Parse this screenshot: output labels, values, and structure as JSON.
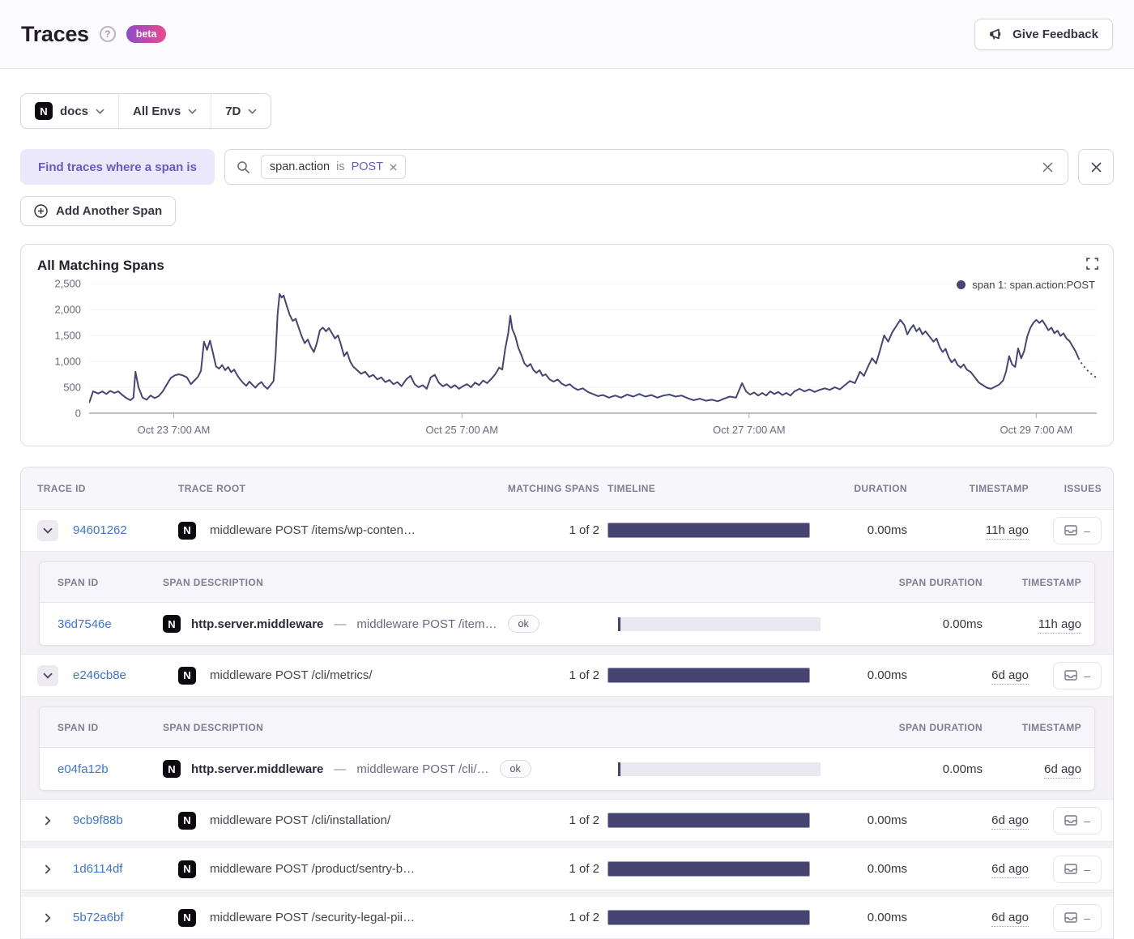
{
  "colors": {
    "accent_purple": "#675ac8",
    "link_blue": "#3d74db",
    "chart_line": "#444674",
    "beta_gradient_from": "#8d4bc9",
    "beta_gradient_to": "#ec4a8c"
  },
  "header": {
    "title": "Traces",
    "beta_label": "beta",
    "feedback_label": "Give Feedback",
    "help_glyph": "?"
  },
  "filters": {
    "project_initial": "N",
    "project": "docs",
    "environment": "All Envs",
    "period": "7D"
  },
  "search": {
    "find_label": "Find traces where a span is",
    "chip": {
      "key": "span.action",
      "op": "is",
      "value": "POST"
    },
    "add_span_label": "Add Another Span"
  },
  "chart_data": {
    "type": "line",
    "title": "All Matching Spans",
    "xlabel": "",
    "ylabel": "",
    "ylim": [
      0,
      2500
    ],
    "y_ticks": [
      0,
      500,
      1000,
      1500,
      2000,
      2500
    ],
    "grid": true,
    "legend_position": "top-right",
    "x_ticks": [
      {
        "label": "Oct 23 7:00 AM",
        "pos": 0.084
      },
      {
        "label": "Oct 25 7:00 AM",
        "pos": 0.37
      },
      {
        "label": "Oct 27 7:00 AM",
        "pos": 0.655
      },
      {
        "label": "Oct 29 7:00 AM",
        "pos": 0.94
      }
    ],
    "dashed_tail_points": 5,
    "series": [
      {
        "name": "span 1: span.action:POST",
        "color": "#444674",
        "points": [
          [
            0.0,
            200
          ],
          [
            0.004,
            420
          ],
          [
            0.009,
            380
          ],
          [
            0.013,
            420
          ],
          [
            0.017,
            370
          ],
          [
            0.021,
            430
          ],
          [
            0.025,
            390
          ],
          [
            0.029,
            420
          ],
          [
            0.033,
            350
          ],
          [
            0.037,
            290
          ],
          [
            0.041,
            250
          ],
          [
            0.044,
            300
          ],
          [
            0.046,
            800
          ],
          [
            0.049,
            500
          ],
          [
            0.053,
            300
          ],
          [
            0.057,
            260
          ],
          [
            0.061,
            340
          ],
          [
            0.065,
            290
          ],
          [
            0.069,
            330
          ],
          [
            0.073,
            420
          ],
          [
            0.077,
            550
          ],
          [
            0.081,
            680
          ],
          [
            0.085,
            730
          ],
          [
            0.089,
            750
          ],
          [
            0.093,
            730
          ],
          [
            0.097,
            690
          ],
          [
            0.101,
            560
          ],
          [
            0.105,
            640
          ],
          [
            0.108,
            700
          ],
          [
            0.111,
            820
          ],
          [
            0.114,
            1380
          ],
          [
            0.117,
            1220
          ],
          [
            0.12,
            1400
          ],
          [
            0.123,
            1150
          ],
          [
            0.126,
            900
          ],
          [
            0.129,
            860
          ],
          [
            0.132,
            930
          ],
          [
            0.135,
            830
          ],
          [
            0.138,
            890
          ],
          [
            0.141,
            790
          ],
          [
            0.144,
            840
          ],
          [
            0.147,
            730
          ],
          [
            0.15,
            650
          ],
          [
            0.153,
            580
          ],
          [
            0.156,
            530
          ],
          [
            0.159,
            610
          ],
          [
            0.162,
            550
          ],
          [
            0.165,
            490
          ],
          [
            0.168,
            560
          ],
          [
            0.171,
            600
          ],
          [
            0.174,
            520
          ],
          [
            0.177,
            470
          ],
          [
            0.18,
            540
          ],
          [
            0.183,
            620
          ],
          [
            0.185,
            1100
          ],
          [
            0.187,
            1900
          ],
          [
            0.189,
            2300
          ],
          [
            0.191,
            2230
          ],
          [
            0.193,
            2270
          ],
          [
            0.196,
            2080
          ],
          [
            0.199,
            1900
          ],
          [
            0.202,
            1780
          ],
          [
            0.205,
            1820
          ],
          [
            0.208,
            1650
          ],
          [
            0.211,
            1480
          ],
          [
            0.214,
            1350
          ],
          [
            0.217,
            1420
          ],
          [
            0.22,
            1280
          ],
          [
            0.223,
            1180
          ],
          [
            0.226,
            1350
          ],
          [
            0.229,
            1600
          ],
          [
            0.232,
            1650
          ],
          [
            0.235,
            1580
          ],
          [
            0.238,
            1640
          ],
          [
            0.241,
            1540
          ],
          [
            0.244,
            1440
          ],
          [
            0.247,
            1500
          ],
          [
            0.25,
            1320
          ],
          [
            0.253,
            1100
          ],
          [
            0.256,
            1180
          ],
          [
            0.259,
            1000
          ],
          [
            0.262,
            900
          ],
          [
            0.266,
            830
          ],
          [
            0.27,
            760
          ],
          [
            0.274,
            800
          ],
          [
            0.278,
            700
          ],
          [
            0.282,
            740
          ],
          [
            0.286,
            650
          ],
          [
            0.29,
            690
          ],
          [
            0.294,
            600
          ],
          [
            0.298,
            640
          ],
          [
            0.302,
            560
          ],
          [
            0.306,
            600
          ],
          [
            0.31,
            520
          ],
          [
            0.315,
            660
          ],
          [
            0.319,
            720
          ],
          [
            0.323,
            560
          ],
          [
            0.327,
            500
          ],
          [
            0.331,
            540
          ],
          [
            0.335,
            470
          ],
          [
            0.339,
            690
          ],
          [
            0.343,
            740
          ],
          [
            0.347,
            590
          ],
          [
            0.351,
            520
          ],
          [
            0.355,
            560
          ],
          [
            0.359,
            490
          ],
          [
            0.363,
            540
          ],
          [
            0.367,
            470
          ],
          [
            0.371,
            520
          ],
          [
            0.375,
            560
          ],
          [
            0.379,
            500
          ],
          [
            0.383,
            590
          ],
          [
            0.387,
            540
          ],
          [
            0.391,
            630
          ],
          [
            0.395,
            580
          ],
          [
            0.399,
            660
          ],
          [
            0.403,
            750
          ],
          [
            0.407,
            880
          ],
          [
            0.41,
            840
          ],
          [
            0.413,
            1250
          ],
          [
            0.416,
            1550
          ],
          [
            0.418,
            1880
          ],
          [
            0.42,
            1620
          ],
          [
            0.423,
            1480
          ],
          [
            0.426,
            1260
          ],
          [
            0.429,
            1120
          ],
          [
            0.432,
            960
          ],
          [
            0.435,
            900
          ],
          [
            0.438,
            950
          ],
          [
            0.441,
            830
          ],
          [
            0.444,
            780
          ],
          [
            0.447,
            830
          ],
          [
            0.45,
            720
          ],
          [
            0.453,
            750
          ],
          [
            0.457,
            650
          ],
          [
            0.461,
            610
          ],
          [
            0.465,
            650
          ],
          [
            0.469,
            570
          ],
          [
            0.473,
            530
          ],
          [
            0.477,
            560
          ],
          [
            0.481,
            490
          ],
          [
            0.485,
            450
          ],
          [
            0.49,
            480
          ],
          [
            0.495,
            410
          ],
          [
            0.5,
            370
          ],
          [
            0.505,
            330
          ],
          [
            0.51,
            350
          ],
          [
            0.516,
            300
          ],
          [
            0.522,
            340
          ],
          [
            0.528,
            300
          ],
          [
            0.534,
            360
          ],
          [
            0.54,
            320
          ],
          [
            0.546,
            370
          ],
          [
            0.552,
            320
          ],
          [
            0.558,
            350
          ],
          [
            0.564,
            300
          ],
          [
            0.57,
            340
          ],
          [
            0.576,
            360
          ],
          [
            0.582,
            320
          ],
          [
            0.588,
            340
          ],
          [
            0.594,
            290
          ],
          [
            0.6,
            250
          ],
          [
            0.606,
            280
          ],
          [
            0.612,
            240
          ],
          [
            0.618,
            260
          ],
          [
            0.624,
            230
          ],
          [
            0.63,
            280
          ],
          [
            0.636,
            320
          ],
          [
            0.642,
            300
          ],
          [
            0.648,
            580
          ],
          [
            0.652,
            420
          ],
          [
            0.656,
            360
          ],
          [
            0.66,
            400
          ],
          [
            0.664,
            340
          ],
          [
            0.668,
            390
          ],
          [
            0.672,
            340
          ],
          [
            0.676,
            420
          ],
          [
            0.68,
            370
          ],
          [
            0.684,
            410
          ],
          [
            0.688,
            350
          ],
          [
            0.692,
            390
          ],
          [
            0.696,
            340
          ],
          [
            0.7,
            420
          ],
          [
            0.705,
            470
          ],
          [
            0.71,
            420
          ],
          [
            0.715,
            460
          ],
          [
            0.72,
            410
          ],
          [
            0.725,
            450
          ],
          [
            0.73,
            480
          ],
          [
            0.735,
            450
          ],
          [
            0.74,
            500
          ],
          [
            0.745,
            460
          ],
          [
            0.75,
            540
          ],
          [
            0.755,
            620
          ],
          [
            0.76,
            580
          ],
          [
            0.765,
            800
          ],
          [
            0.769,
            720
          ],
          [
            0.773,
            900
          ],
          [
            0.777,
            1060
          ],
          [
            0.781,
            960
          ],
          [
            0.785,
            1220
          ],
          [
            0.789,
            1500
          ],
          [
            0.793,
            1380
          ],
          [
            0.797,
            1560
          ],
          [
            0.801,
            1680
          ],
          [
            0.805,
            1800
          ],
          [
            0.809,
            1700
          ],
          [
            0.812,
            1520
          ],
          [
            0.815,
            1620
          ],
          [
            0.818,
            1700
          ],
          [
            0.821,
            1580
          ],
          [
            0.824,
            1640
          ],
          [
            0.827,
            1520
          ],
          [
            0.83,
            1580
          ],
          [
            0.834,
            1480
          ],
          [
            0.838,
            1380
          ],
          [
            0.841,
            1440
          ],
          [
            0.844,
            1280
          ],
          [
            0.847,
            1180
          ],
          [
            0.85,
            1240
          ],
          [
            0.853,
            1080
          ],
          [
            0.856,
            980
          ],
          [
            0.859,
            1040
          ],
          [
            0.862,
            930
          ],
          [
            0.865,
            880
          ],
          [
            0.868,
            940
          ],
          [
            0.871,
            840
          ],
          [
            0.875,
            790
          ],
          [
            0.879,
            690
          ],
          [
            0.883,
            590
          ],
          [
            0.887,
            540
          ],
          [
            0.891,
            490
          ],
          [
            0.895,
            470
          ],
          [
            0.899,
            510
          ],
          [
            0.903,
            550
          ],
          [
            0.907,
            630
          ],
          [
            0.91,
            800
          ],
          [
            0.913,
            1100
          ],
          [
            0.916,
            940
          ],
          [
            0.919,
            890
          ],
          [
            0.922,
            1250
          ],
          [
            0.925,
            1060
          ],
          [
            0.928,
            1200
          ],
          [
            0.931,
            1480
          ],
          [
            0.934,
            1640
          ],
          [
            0.937,
            1740
          ],
          [
            0.94,
            1800
          ],
          [
            0.943,
            1740
          ],
          [
            0.946,
            1790
          ],
          [
            0.949,
            1700
          ],
          [
            0.952,
            1600
          ],
          [
            0.955,
            1650
          ],
          [
            0.958,
            1540
          ],
          [
            0.961,
            1590
          ],
          [
            0.964,
            1490
          ],
          [
            0.967,
            1540
          ],
          [
            0.97,
            1440
          ],
          [
            0.973,
            1390
          ],
          [
            0.976,
            1290
          ],
          [
            0.979,
            1190
          ],
          [
            0.982,
            1060
          ],
          [
            0.985,
            960
          ],
          [
            0.989,
            860
          ],
          [
            0.993,
            780
          ],
          [
            1.0,
            680
          ]
        ]
      }
    ]
  },
  "table": {
    "columns": [
      "TRACE ID",
      "TRACE ROOT",
      "MATCHING SPANS",
      "TIMELINE",
      "DURATION",
      "TIMESTAMP",
      "ISSUES"
    ],
    "span_columns": [
      "SPAN ID",
      "SPAN DESCRIPTION",
      "SPAN DURATION",
      "TIMESTAMP"
    ],
    "issues_empty": "–",
    "span_separator": "—",
    "traces": [
      {
        "id": "94601262",
        "root": "middleware POST /items/wp-conten…",
        "matching": "1 of 2",
        "duration": "0.00ms",
        "timestamp": "11h ago",
        "expanded": true,
        "spans": [
          {
            "id": "36d7546e",
            "op": "http.server.middleware",
            "description": "middleware POST /item…",
            "status": "ok",
            "duration": "0.00ms",
            "timestamp": "11h ago"
          }
        ]
      },
      {
        "id": "e246cb8e",
        "root": "middleware POST /cli/metrics/",
        "matching": "1 of 2",
        "duration": "0.00ms",
        "timestamp": "6d ago",
        "expanded": true,
        "spans": [
          {
            "id": "e04fa12b",
            "op": "http.server.middleware",
            "description": "middleware POST /cli/…",
            "status": "ok",
            "duration": "0.00ms",
            "timestamp": "6d ago"
          }
        ]
      },
      {
        "id": "9cb9f88b",
        "root": "middleware POST /cli/installation/",
        "matching": "1 of 2",
        "duration": "0.00ms",
        "timestamp": "6d ago",
        "expanded": false
      },
      {
        "id": "1d6114df",
        "root": "middleware POST /product/sentry-b…",
        "matching": "1 of 2",
        "duration": "0.00ms",
        "timestamp": "6d ago",
        "expanded": false
      },
      {
        "id": "5b72a6bf",
        "root": "middleware POST /security-legal-pii…",
        "matching": "1 of 2",
        "duration": "0.00ms",
        "timestamp": "6d ago",
        "expanded": false
      }
    ]
  }
}
